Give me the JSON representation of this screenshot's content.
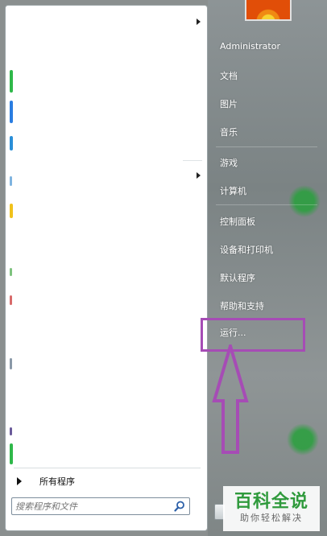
{
  "start_menu": {
    "user_name": "Administrator",
    "items": [
      {
        "label": "文档"
      },
      {
        "label": "图片"
      },
      {
        "label": "音乐"
      },
      {
        "label": "游戏"
      },
      {
        "label": "计算机"
      },
      {
        "label": "控制面板"
      },
      {
        "label": "设备和打印机"
      },
      {
        "label": "默认程序"
      },
      {
        "label": "帮助和支持"
      },
      {
        "label": "运行..."
      }
    ],
    "all_programs": "所有程序",
    "search_placeholder": "搜索程序和文件"
  },
  "watermark": {
    "title": "百科全说",
    "subtitle": "助你轻松解决"
  },
  "colors": {
    "highlight": "#a64cb5",
    "watermark_green": "#2f9a3c"
  }
}
